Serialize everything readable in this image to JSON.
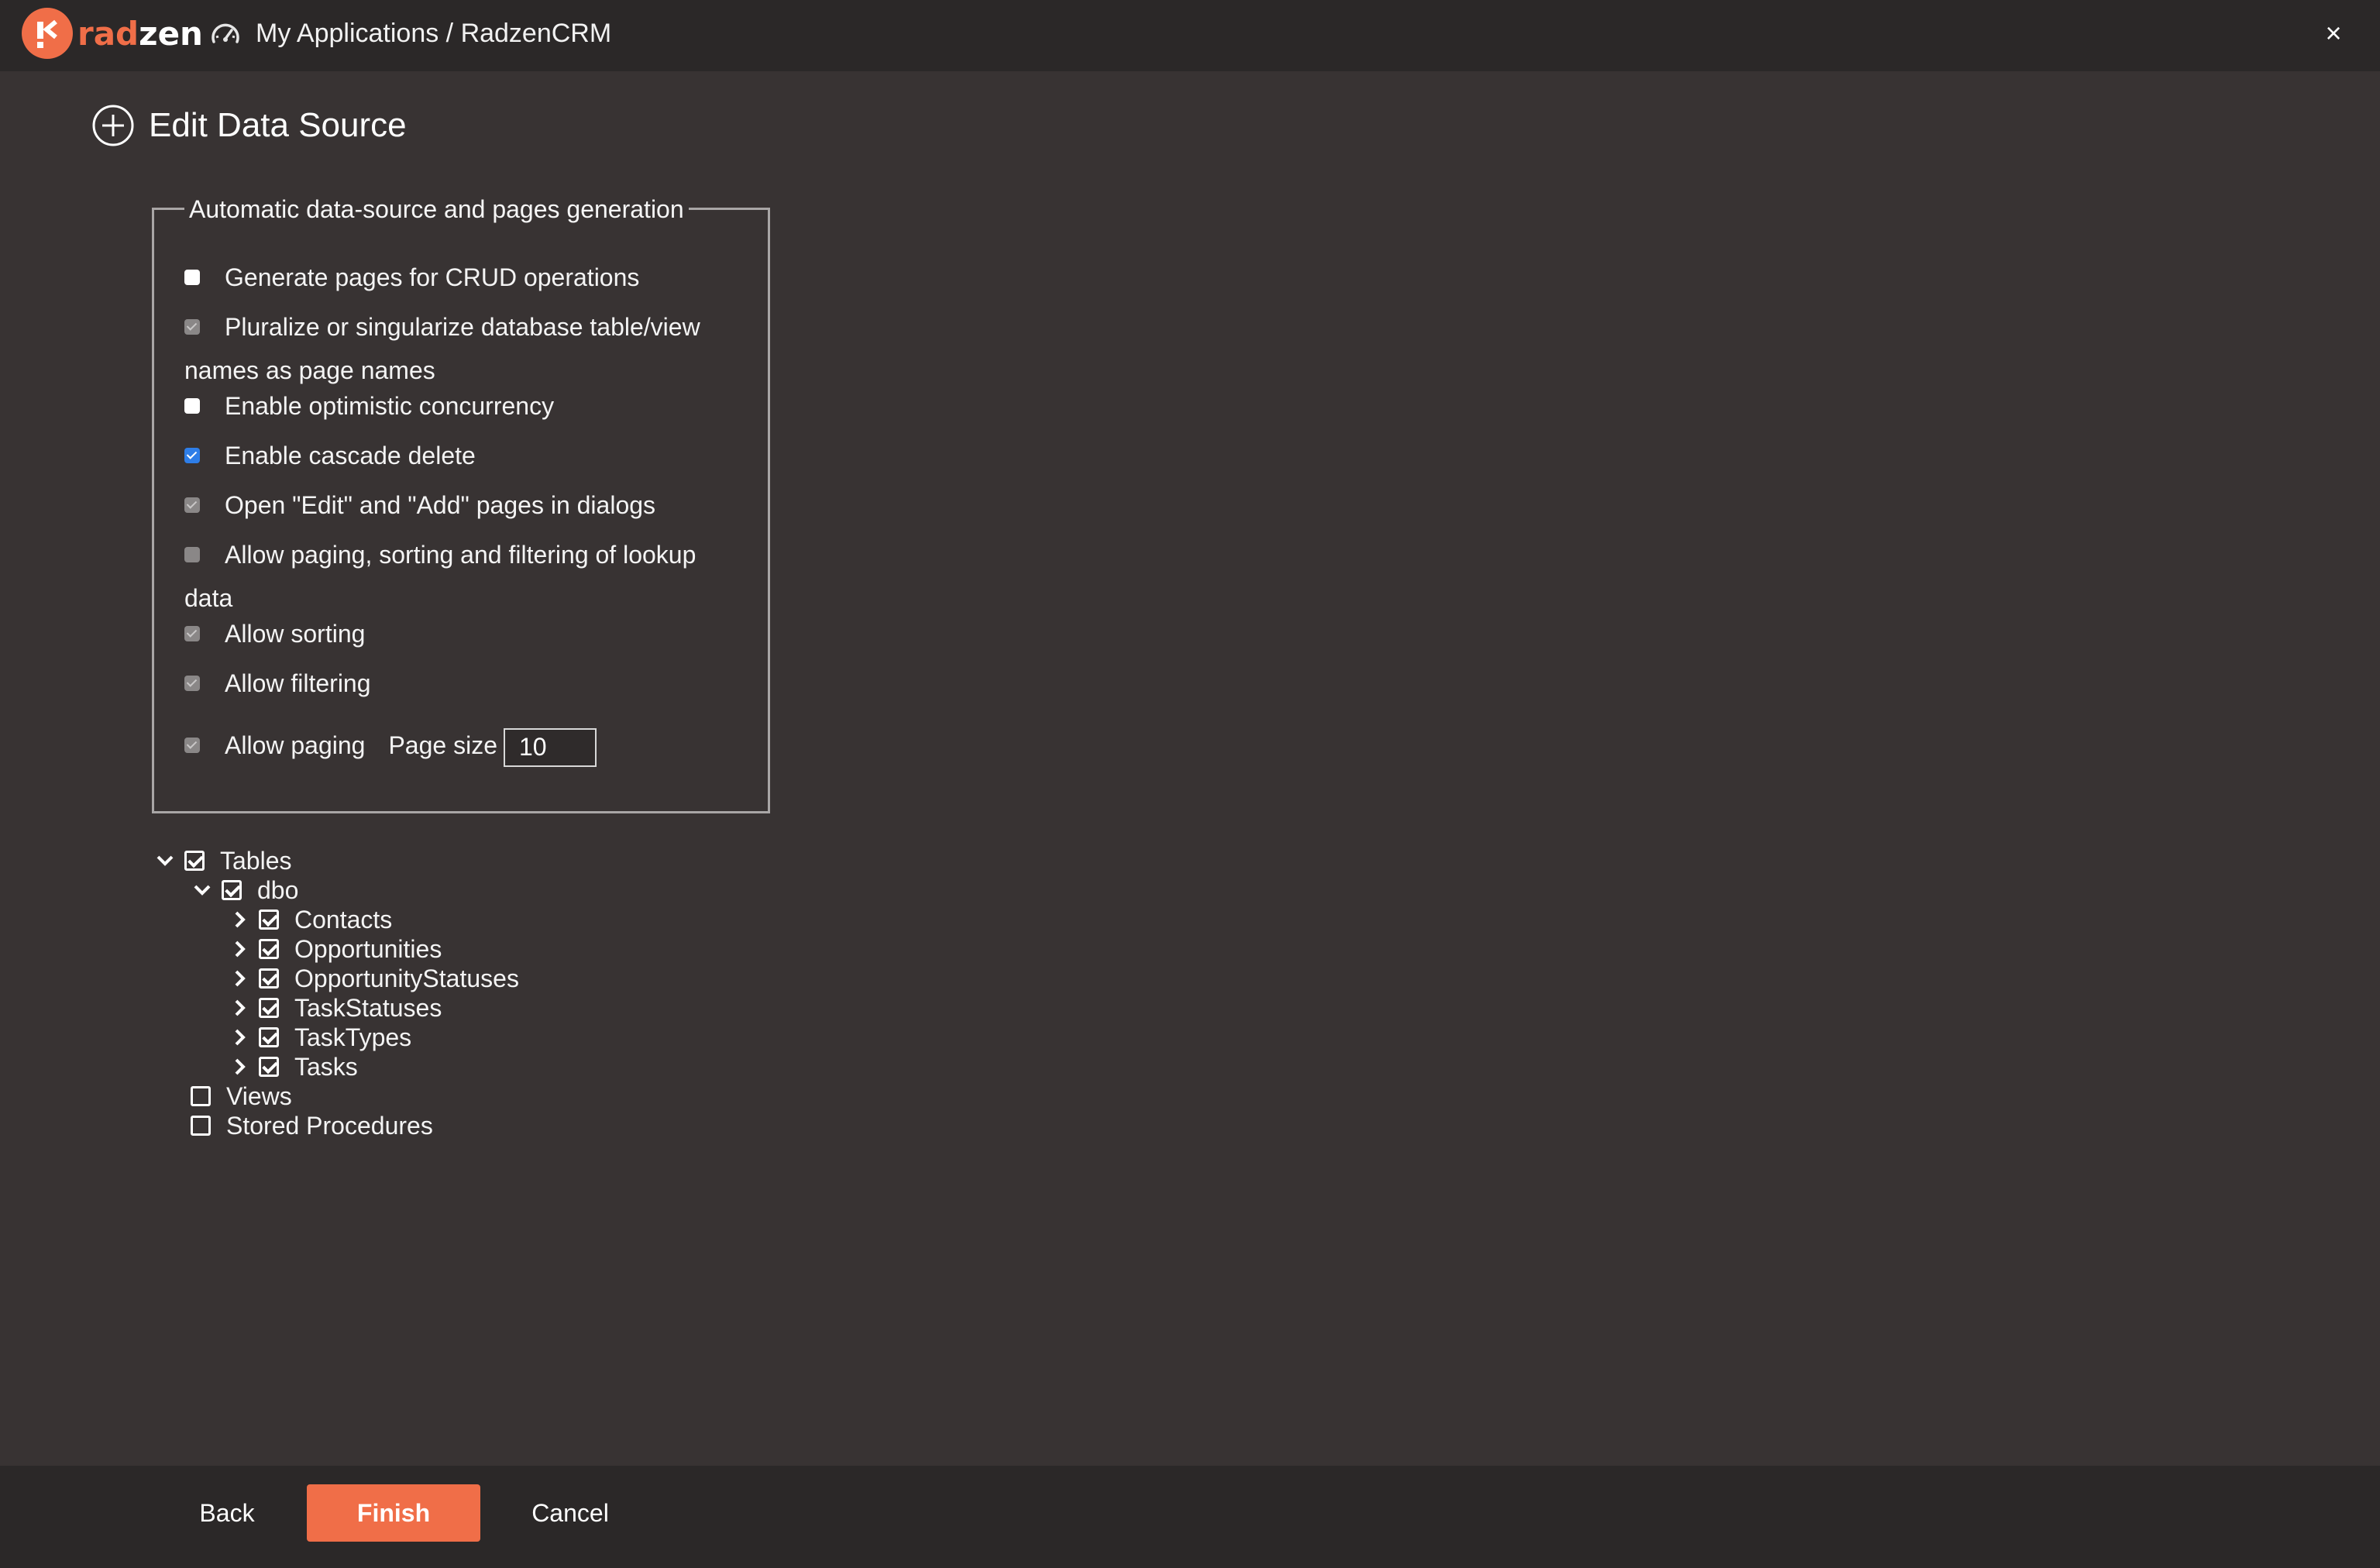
{
  "header": {
    "logo_rad": "rad",
    "logo_zen": "zen",
    "breadcrumb": "My Applications / RadzenCRM",
    "close_label": "×",
    "brand_color": "#f06e48"
  },
  "page": {
    "title": "Edit Data Source"
  },
  "generation": {
    "legend": "Automatic data-source and pages generation",
    "options": {
      "crud": {
        "label": "Generate pages for CRUD operations",
        "checked": false
      },
      "pluralize": {
        "label": "Pluralize or singularize database table/view names as page names",
        "checked": true,
        "disabled": true
      },
      "concurrency": {
        "label": "Enable optimistic concurrency",
        "checked": false
      },
      "cascade": {
        "label": "Enable cascade delete",
        "checked": true
      },
      "dialogs": {
        "label": "Open \"Edit\" and \"Add\" pages in dialogs",
        "checked": true,
        "disabled": true
      },
      "lookup": {
        "label": "Allow paging, sorting and filtering of lookup data",
        "checked": false,
        "disabled": true
      },
      "sorting": {
        "label": "Allow sorting",
        "checked": true,
        "disabled": true
      },
      "filtering": {
        "label": "Allow filtering",
        "checked": true,
        "disabled": true
      },
      "paging": {
        "label": "Allow paging",
        "checked": true,
        "disabled": true
      }
    },
    "page_size_label": "Page size",
    "page_size_value": "10"
  },
  "tree": {
    "tables": "Tables",
    "schema": "dbo",
    "items": [
      "Contacts",
      "Opportunities",
      "OpportunityStatuses",
      "TaskStatuses",
      "TaskTypes",
      "Tasks"
    ],
    "views": "Views",
    "procedures": "Stored Procedures"
  },
  "footer": {
    "back": "Back",
    "finish": "Finish",
    "cancel": "Cancel"
  }
}
